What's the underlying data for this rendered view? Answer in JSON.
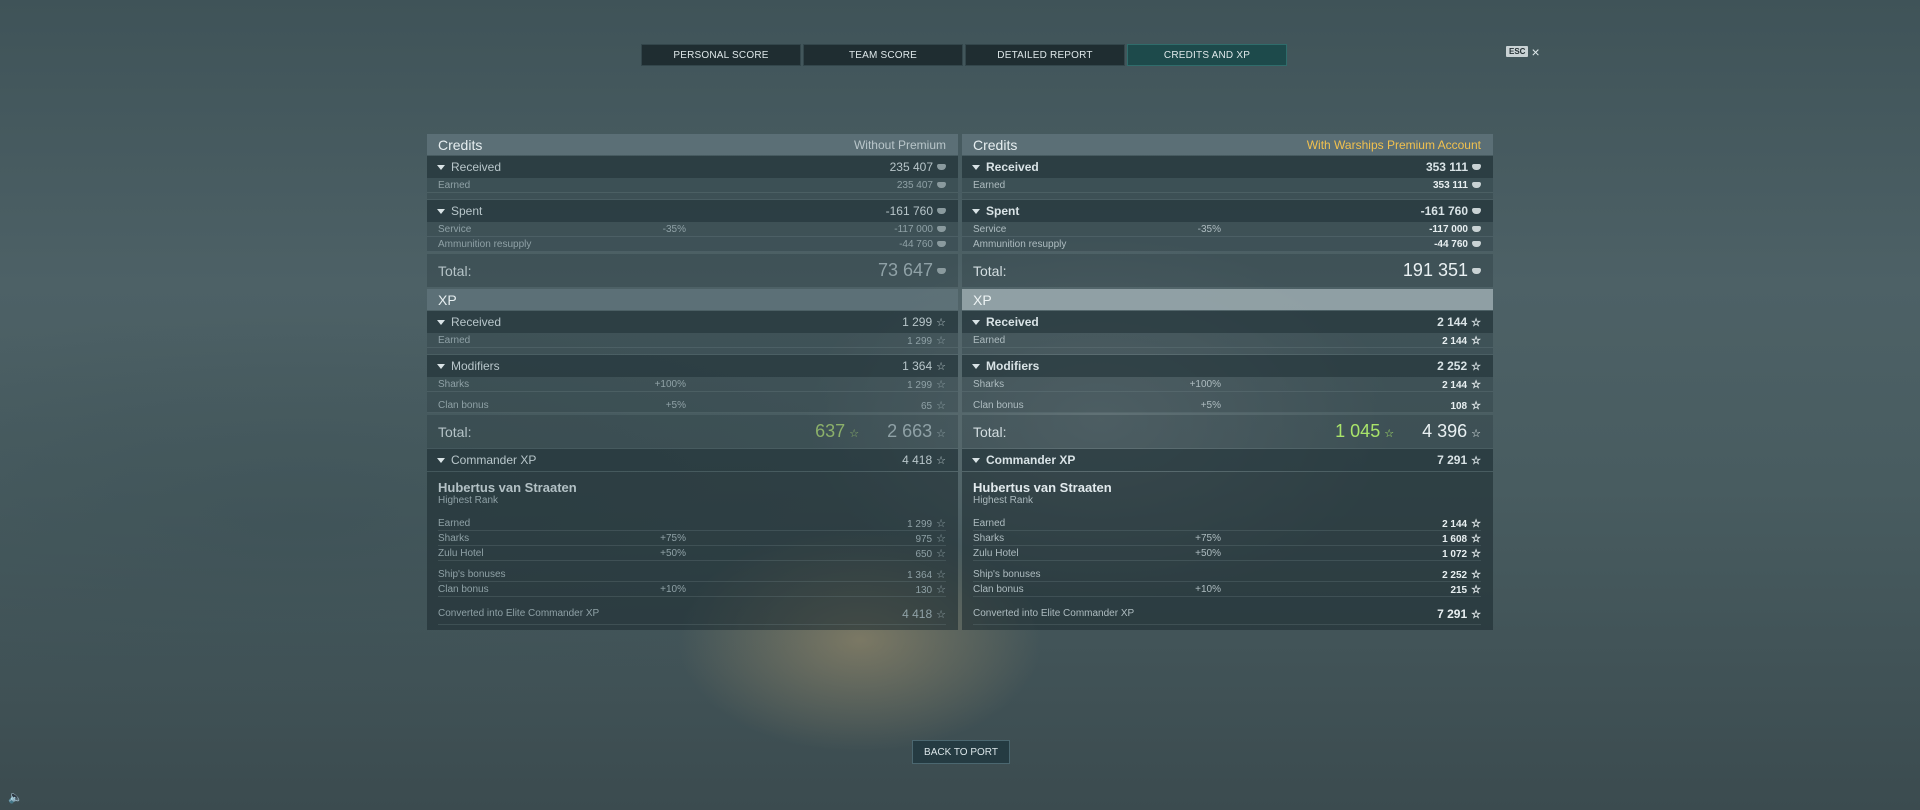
{
  "tabs": [
    {
      "label": "PERSONAL SCORE",
      "active": false
    },
    {
      "label": "TEAM SCORE",
      "active": false
    },
    {
      "label": "DETAILED REPORT",
      "active": false
    },
    {
      "label": "CREDITS AND XP",
      "active": true
    }
  ],
  "esc": {
    "key": "ESC",
    "close": "×"
  },
  "left": {
    "credits_title": "Credits",
    "credits_tag": "Without Premium",
    "received": {
      "label": "Received",
      "value": "235 407"
    },
    "earned": {
      "label": "Earned",
      "value": "235 407"
    },
    "spent": {
      "label": "Spent",
      "value": "-161 760"
    },
    "service": {
      "label": "Service",
      "pct": "-35%",
      "value": "-117 000"
    },
    "ammo": {
      "label": "Ammunition resupply",
      "value": "-44 760"
    },
    "credits_total": {
      "label": "Total:",
      "value": "73 647"
    },
    "xp_title": "XP",
    "xp_received": {
      "label": "Received",
      "value": "1 299"
    },
    "xp_earned": {
      "label": "Earned",
      "value": "1 299"
    },
    "modifiers": {
      "label": "Modifiers",
      "value": "1 364"
    },
    "sharks": {
      "label": "Sharks",
      "pct": "+100%",
      "value": "1 299"
    },
    "clan": {
      "label": "Clan bonus",
      "pct": "+5%",
      "value": "65"
    },
    "xp_total": {
      "label": "Total:",
      "free": "637",
      "value": "2 663"
    },
    "commander": {
      "label": "Commander XP",
      "value": "4 418"
    },
    "cmd_name": "Hubertus van Straaten",
    "cmd_rank": "Highest Rank",
    "c_earned": {
      "label": "Earned",
      "value": "1 299"
    },
    "c_sharks": {
      "label": "Sharks",
      "pct": "+75%",
      "value": "975"
    },
    "c_zulu": {
      "label": "Zulu Hotel",
      "pct": "+50%",
      "value": "650"
    },
    "c_ship": {
      "label": "Ship's bonuses",
      "value": "1 364"
    },
    "c_clan": {
      "label": "Clan bonus",
      "pct": "+10%",
      "value": "130"
    },
    "c_conv": {
      "label": "Converted into Elite Commander XP",
      "value": "4 418"
    }
  },
  "right": {
    "credits_title": "Credits",
    "credits_tag": "With Warships Premium Account",
    "received": {
      "label": "Received",
      "value": "353 111"
    },
    "earned": {
      "label": "Earned",
      "value": "353 111"
    },
    "spent": {
      "label": "Spent",
      "value": "-161 760"
    },
    "service": {
      "label": "Service",
      "pct": "-35%",
      "value": "-117 000"
    },
    "ammo": {
      "label": "Ammunition resupply",
      "value": "-44 760"
    },
    "credits_total": {
      "label": "Total:",
      "value": "191 351"
    },
    "xp_title": "XP",
    "xp_received": {
      "label": "Received",
      "value": "2 144"
    },
    "xp_earned": {
      "label": "Earned",
      "value": "2 144"
    },
    "modifiers": {
      "label": "Modifiers",
      "value": "2 252"
    },
    "sharks": {
      "label": "Sharks",
      "pct": "+100%",
      "value": "2 144"
    },
    "clan": {
      "label": "Clan bonus",
      "pct": "+5%",
      "value": "108"
    },
    "xp_total": {
      "label": "Total:",
      "free": "1 045",
      "value": "4 396"
    },
    "commander": {
      "label": "Commander XP",
      "value": "7 291"
    },
    "cmd_name": "Hubertus van Straaten",
    "cmd_rank": "Highest Rank",
    "c_earned": {
      "label": "Earned",
      "value": "2 144"
    },
    "c_sharks": {
      "label": "Sharks",
      "pct": "+75%",
      "value": "1 608"
    },
    "c_zulu": {
      "label": "Zulu Hotel",
      "pct": "+50%",
      "value": "1 072"
    },
    "c_ship": {
      "label": "Ship's bonuses",
      "value": "2 252"
    },
    "c_clan": {
      "label": "Clan bonus",
      "pct": "+10%",
      "value": "215"
    },
    "c_conv": {
      "label": "Converted into Elite Commander XP",
      "value": "7 291"
    }
  },
  "icons": {
    "star": "☆",
    "credits": "credits-icon"
  },
  "colors": {
    "premium": "#f2c14e",
    "free_xp": "#a9e46a",
    "active_tab": "#1d4a4b"
  },
  "back_button": "BACK TO PORT",
  "sound_icon": "🔈"
}
